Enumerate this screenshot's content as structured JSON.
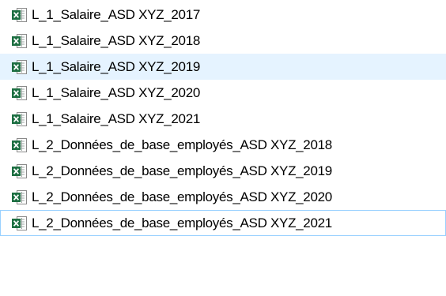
{
  "file_list": {
    "icon": "excel-file-icon",
    "accent_color": "#1d6f42",
    "selected_color": "#e5f3ff",
    "items": [
      {
        "name": "L_1_Salaire_ASD XYZ_2017",
        "state": "normal"
      },
      {
        "name": "L_1_Salaire_ASD XYZ_2018",
        "state": "normal"
      },
      {
        "name": "L_1_Salaire_ASD XYZ_2019",
        "state": "selected"
      },
      {
        "name": "L_1_Salaire_ASD XYZ_2020",
        "state": "normal"
      },
      {
        "name": "L_1_Salaire_ASD XYZ_2021",
        "state": "normal"
      },
      {
        "name": "L_2_Données_de_base_employés_ASD XYZ_2018",
        "state": "normal"
      },
      {
        "name": "L_2_Données_de_base_employés_ASD XYZ_2019",
        "state": "normal"
      },
      {
        "name": "L_2_Données_de_base_employés_ASD XYZ_2020",
        "state": "normal"
      },
      {
        "name": "L_2_Données_de_base_employés_ASD XYZ_2021",
        "state": "focused"
      }
    ]
  }
}
